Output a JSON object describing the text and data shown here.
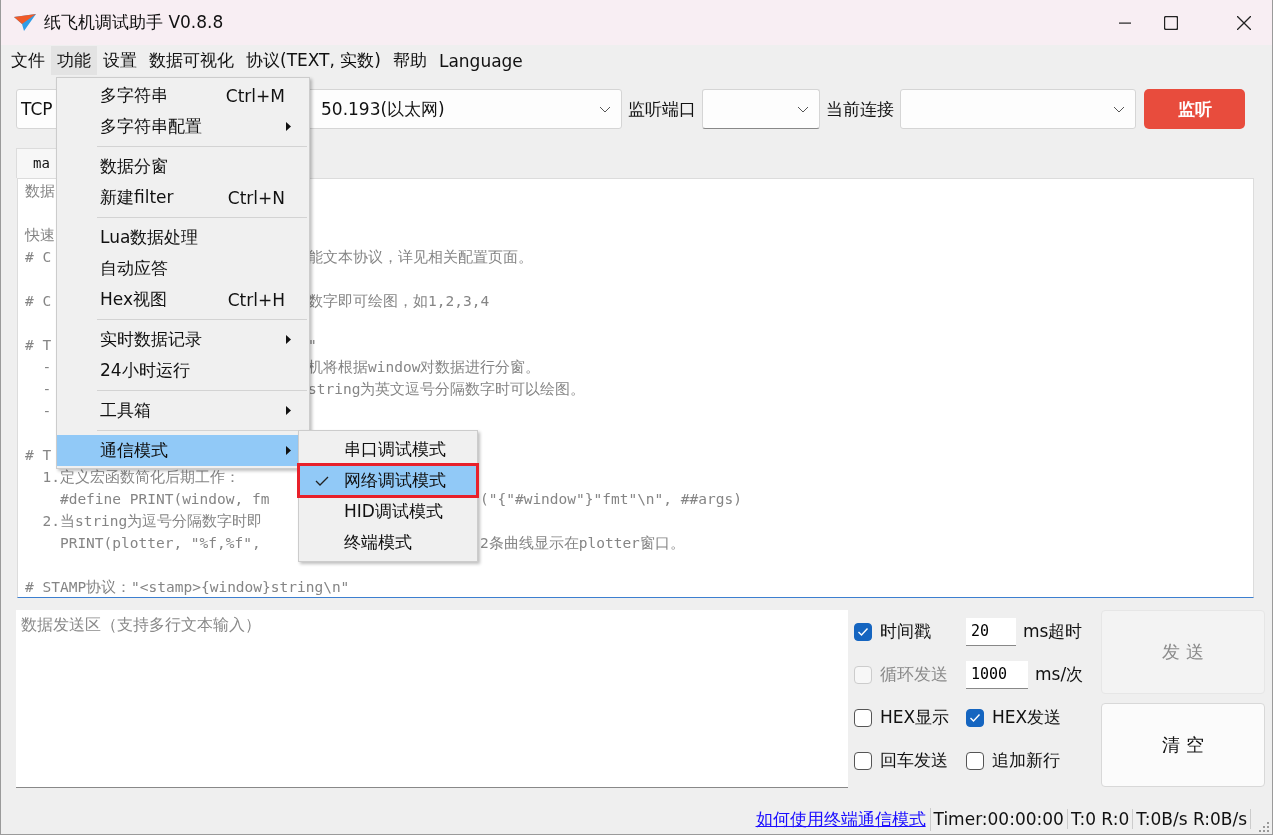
{
  "window": {
    "title": "纸飞机调试助手 V0.8.8"
  },
  "menubar": [
    {
      "label": "文件",
      "selected": false
    },
    {
      "label": "功能",
      "selected": true
    },
    {
      "label": "设置",
      "selected": false
    },
    {
      "label": "数据可视化",
      "selected": false
    },
    {
      "label": "协议(TEXT, 实数)",
      "selected": false
    },
    {
      "label": "帮助",
      "selected": false
    },
    {
      "label": "Language",
      "selected": false
    }
  ],
  "toolbar": {
    "protocol": "TCP",
    "address": "50.193(以太网)",
    "port_label": "监听端口",
    "connection_label": "当前连接",
    "listen_button": "监听"
  },
  "tabs": [
    {
      "label": "ma",
      "selected": true
    }
  ],
  "log": [
    {
      "kind": "menu",
      "left": "数据"
    },
    {
      "kind": "blank"
    },
    {
      "kind": "menu",
      "left": "快速"
    },
    {
      "kind": "menu",
      "left": "# C",
      "right": "能文本协议，详见相关配置页面。"
    },
    {
      "kind": "blank"
    },
    {
      "kind": "menu",
      "left": "# C",
      "right": "数字即可绘图，如1,2,3,4"
    },
    {
      "kind": "blank"
    },
    {
      "kind": "menu",
      "left": "# T",
      "right": "\""
    },
    {
      "kind": "menu",
      "left": "  -",
      "right": "机将根据window对数据进行分窗。"
    },
    {
      "kind": "menu",
      "left": "  -",
      "right": "string为英文逗号分隔数字时可以绘图。"
    },
    {
      "kind": "menu",
      "left": "  -"
    },
    {
      "kind": "blank"
    },
    {
      "kind": "menu",
      "left": "# T"
    },
    {
      "kind": "sub",
      "left": "  1.定义宏函数简化后期工作："
    },
    {
      "kind": "sub",
      "left": "    #define PRINT(window, fm",
      "right": "(\"{\"#window\"}\"fmt\"\\n\", ##args)"
    },
    {
      "kind": "sub",
      "left": "  2.当string为逗号分隔数字时即"
    },
    {
      "kind": "sub",
      "left": "    PRINT(plotter, \"%f,%f\",",
      "right": "2条曲线显示在plotter窗口。"
    },
    {
      "kind": "blank"
    },
    {
      "kind": "full",
      "left": "# STAMP协议：\"<stamp>{window}string\\n\""
    }
  ],
  "menu": [
    {
      "kind": "item",
      "label": "多字符串",
      "shortcut": "Ctrl+M",
      "has_submenu": false,
      "selected": false
    },
    {
      "kind": "item",
      "label": "多字符串配置",
      "has_submenu": true,
      "selected": false
    },
    {
      "kind": "separator"
    },
    {
      "kind": "item",
      "label": "数据分窗",
      "has_submenu": false,
      "selected": false
    },
    {
      "kind": "item",
      "label": "新建filter",
      "shortcut": "Ctrl+N",
      "has_submenu": false,
      "selected": false
    },
    {
      "kind": "separator"
    },
    {
      "kind": "item",
      "label": "Lua数据处理",
      "has_submenu": false,
      "selected": false
    },
    {
      "kind": "item",
      "label": "自动应答",
      "has_submenu": false,
      "selected": false
    },
    {
      "kind": "item",
      "label": "Hex视图",
      "shortcut": "Ctrl+H",
      "has_submenu": false,
      "selected": false
    },
    {
      "kind": "separator"
    },
    {
      "kind": "item",
      "label": "实时数据记录",
      "has_submenu": true,
      "selected": false
    },
    {
      "kind": "item",
      "label": "24小时运行",
      "has_submenu": false,
      "selected": false
    },
    {
      "kind": "separator"
    },
    {
      "kind": "item",
      "label": "工具箱",
      "has_submenu": true,
      "selected": false
    },
    {
      "kind": "separator"
    },
    {
      "kind": "item",
      "label": "通信模式",
      "has_submenu": true,
      "selected": true
    }
  ],
  "submenu": [
    {
      "label": "串口调试模式",
      "checked": false,
      "selected": false,
      "outlined": false
    },
    {
      "label": "网络调试模式",
      "checked": true,
      "selected": true,
      "outlined": true
    },
    {
      "label": "HID调试模式",
      "checked": false,
      "selected": false,
      "outlined": false
    },
    {
      "label": "终端模式",
      "checked": false,
      "selected": false,
      "outlined": false
    }
  ],
  "send_area": {
    "placeholder": "数据发送区（支持多行文本输入）"
  },
  "options": [
    {
      "kind": "check_input",
      "label": "时间戳",
      "checked": true,
      "disabled": false,
      "value": "20",
      "unit": "ms超时"
    },
    {
      "kind": "check_input",
      "label": "循环发送",
      "checked": false,
      "disabled": true,
      "value": "1000",
      "unit": "ms/次"
    },
    {
      "kind": "check_pair",
      "label": "HEX显示",
      "checked": false,
      "disabled": false,
      "label2": "HEX发送",
      "checked2": true
    },
    {
      "kind": "check_pair",
      "label": "回车发送",
      "checked": false,
      "disabled": false,
      "label2": "追加新行",
      "checked2": false
    }
  ],
  "buttons": [
    {
      "label": "发 送",
      "disabled": true
    },
    {
      "label": "清 空",
      "disabled": false
    }
  ],
  "status_bar": {
    "link": "如何使用终端通信模式",
    "timer": "Timer:00:00:00",
    "counts": "T:0 R:0",
    "rates": "T:0B/s R:0B/s"
  }
}
